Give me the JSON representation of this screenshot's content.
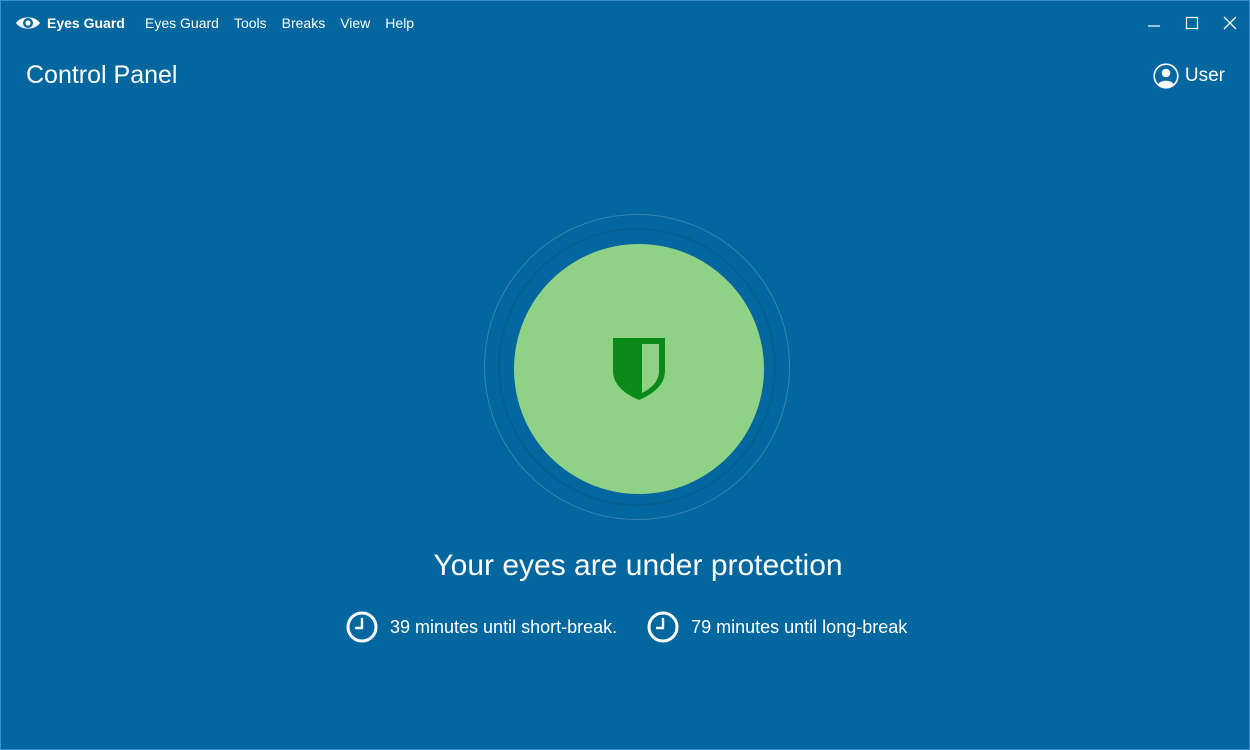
{
  "app": {
    "name": "Eyes Guard",
    "logo_icon": "eye-icon"
  },
  "menu": {
    "items": [
      "Eyes Guard",
      "Tools",
      "Breaks",
      "View",
      "Help"
    ]
  },
  "window_controls": {
    "icons": [
      "minimize-icon",
      "maximize-icon",
      "close-icon"
    ]
  },
  "header": {
    "title": "Control Panel",
    "user_label": "User",
    "user_icon": "user-avatar-icon"
  },
  "status": {
    "icon": "shield-icon",
    "message": "Your eyes are under protection",
    "timers": [
      {
        "icon": "clock-icon",
        "text": "39 minutes until short-break."
      },
      {
        "icon": "clock-icon",
        "text": "79 minutes until long-break"
      }
    ]
  },
  "colors": {
    "background": "#02679e",
    "status_circle": "#8fd185",
    "shield": "#0a8a18",
    "text": "#ffffff"
  }
}
